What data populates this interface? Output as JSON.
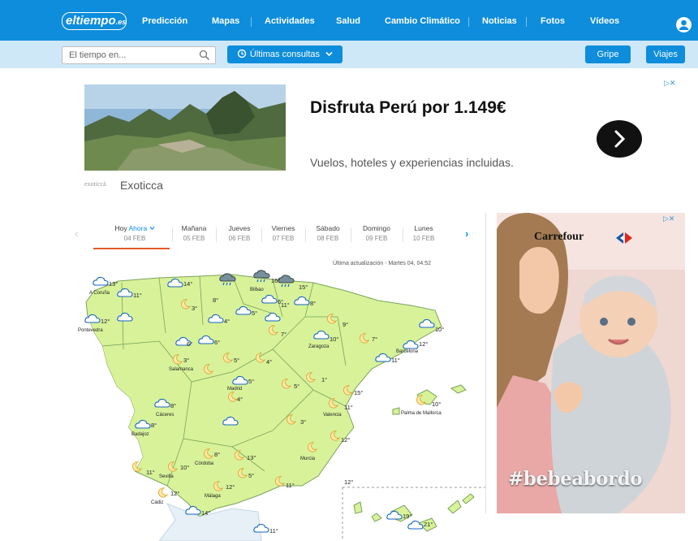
{
  "nav": {
    "logo": "eltiempo",
    "logo_suffix": ".es",
    "items": [
      "Predicción",
      "Mapas",
      "Actividades",
      "Salud",
      "Cambio Climático",
      "Noticias",
      "Fotos",
      "Vídeos"
    ]
  },
  "subnav": {
    "search_placeholder": "El tiempo en...",
    "recent_label": "Últimas consultas",
    "gripe": "Gripe",
    "viajes": "Viajes"
  },
  "ad": {
    "badge": "▷✕",
    "brand_small": "exoticcà",
    "brand": "Exoticca",
    "title": "Disfruta Perú por 1.149€",
    "subtitle": "Vuelos, hoteles y experiencias incluidas."
  },
  "forecast": {
    "days": [
      {
        "name": "Hoy",
        "extra": "Ahora",
        "date": "04 FEB"
      },
      {
        "name": "Mañana",
        "date": "05 FEB"
      },
      {
        "name": "Jueves",
        "date": "06 FEB"
      },
      {
        "name": "Viernes",
        "date": "07 FEB"
      },
      {
        "name": "Sábado",
        "date": "08 FEB"
      },
      {
        "name": "Domingo",
        "date": "09 FEB"
      },
      {
        "name": "Lunes",
        "date": "10 FEB"
      }
    ],
    "updated": "Última actualización - Martes 04, 04:52"
  },
  "map": {
    "cities": [
      {
        "name": "A Coruña",
        "temp": "13°",
        "icon": "cloudy-night"
      },
      {
        "name": "Pontevedra",
        "temp": "12°",
        "icon": "cloudy-night"
      },
      {
        "name": "Bilbao",
        "temp": "16°",
        "icon": "rain"
      },
      {
        "name": "Zaragoza",
        "temp": "10°",
        "icon": "cloudy-night"
      },
      {
        "name": "Barcelona",
        "temp": "12°",
        "icon": "cloudy-night"
      },
      {
        "name": "Salamanca",
        "temp": "3°",
        "icon": "clear-night"
      },
      {
        "name": "Madrid",
        "temp": "5°",
        "icon": "cloudy-night"
      },
      {
        "name": "Cáceres",
        "temp": "8°",
        "icon": "cloudy-night"
      },
      {
        "name": "Badajoz",
        "temp": "8°",
        "icon": "cloudy-night"
      },
      {
        "name": "Valencia",
        "temp": "11°",
        "icon": "clear-night"
      },
      {
        "name": "Palma de Mallorca",
        "temp": "10°",
        "icon": "clear-night"
      },
      {
        "name": "Córdoba",
        "temp": "8°",
        "icon": "clear-night"
      },
      {
        "name": "Sevilla",
        "temp": "10°",
        "icon": "clear-night"
      },
      {
        "name": "Murcia",
        "temp": "12°",
        "icon": "clear-night"
      },
      {
        "name": "Málaga",
        "temp": "12°",
        "icon": "clear-night"
      },
      {
        "name": "Cádiz",
        "temp": "12°",
        "icon": "clear-night"
      }
    ],
    "extra_temps": [
      "11°",
      "14°",
      "15°",
      "6°",
      "3°",
      "9°",
      "10°",
      "4°",
      "5°",
      "7°",
      "1°",
      "6°",
      "11°",
      "8°",
      "7°",
      "11°",
      "4°",
      "5°",
      "6°",
      "15°",
      "5°",
      "8°",
      "4°",
      "3°",
      "12°",
      "13°",
      "5°",
      "11°",
      "11°",
      "14°",
      "11°",
      "21°",
      "19°"
    ]
  },
  "side_ad": {
    "badge": "▷✕",
    "brand": "Carrefour",
    "hashtag": "#bebeabordo"
  }
}
